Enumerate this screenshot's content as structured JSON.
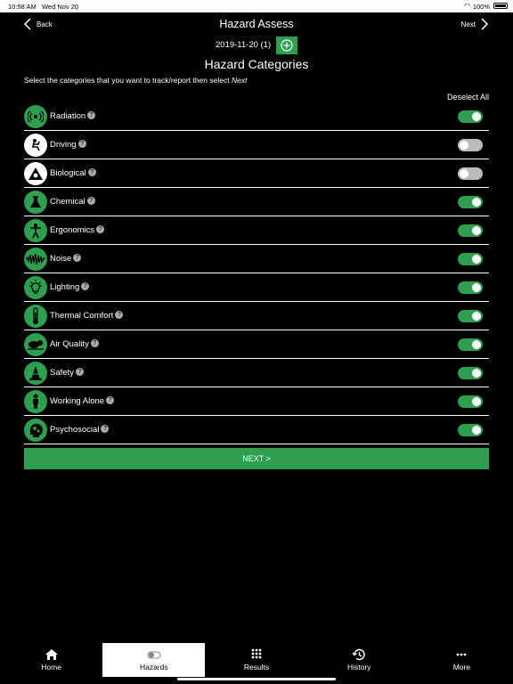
{
  "status": {
    "time": "10:58 AM",
    "date": "Wed Nov 20",
    "battery": "100%"
  },
  "nav": {
    "back_label": "Back",
    "title": "Hazard Assess",
    "next_label": "Next"
  },
  "date_row": {
    "date": "2019-11-20 (1)"
  },
  "heading": "Hazard Categories",
  "instruction": {
    "text": "Select the categories that you want to track/report then select ",
    "emphasis": "Next"
  },
  "deselect_all": "Deselect All",
  "categories": [
    {
      "label": "Radiation",
      "icon": "radiation-icon",
      "enabled": true
    },
    {
      "label": "Driving",
      "icon": "driving-icon",
      "enabled": false
    },
    {
      "label": "Biological",
      "icon": "biological-icon",
      "enabled": false
    },
    {
      "label": "Chemical",
      "icon": "chemical-icon",
      "enabled": true
    },
    {
      "label": "Ergonomics",
      "icon": "ergonomics-icon",
      "enabled": true
    },
    {
      "label": "Noise",
      "icon": "noise-icon",
      "enabled": true
    },
    {
      "label": "Lighting",
      "icon": "lighting-icon",
      "enabled": true
    },
    {
      "label": "Thermal Comfort",
      "icon": "thermometer-icon",
      "enabled": true
    },
    {
      "label": "Air Quality",
      "icon": "air-quality-icon",
      "enabled": true
    },
    {
      "label": "Safety",
      "icon": "safety-cone-icon",
      "enabled": true
    },
    {
      "label": "Working Alone",
      "icon": "person-icon",
      "enabled": true
    },
    {
      "label": "Psychosocial",
      "icon": "head-gears-icon",
      "enabled": true
    }
  ],
  "next_button": "NEXT >",
  "tabs": [
    {
      "label": "Home",
      "icon": "home-icon",
      "active": false
    },
    {
      "label": "Hazards",
      "icon": "toggle-icon",
      "active": true
    },
    {
      "label": "Results",
      "icon": "grid-icon",
      "active": false
    },
    {
      "label": "History",
      "icon": "history-icon",
      "active": false
    },
    {
      "label": "More",
      "icon": "more-icon",
      "active": false
    }
  ],
  "colors": {
    "accent": "#2e9e4f",
    "background": "#000000",
    "toggle_off": "#bbbbbb"
  }
}
